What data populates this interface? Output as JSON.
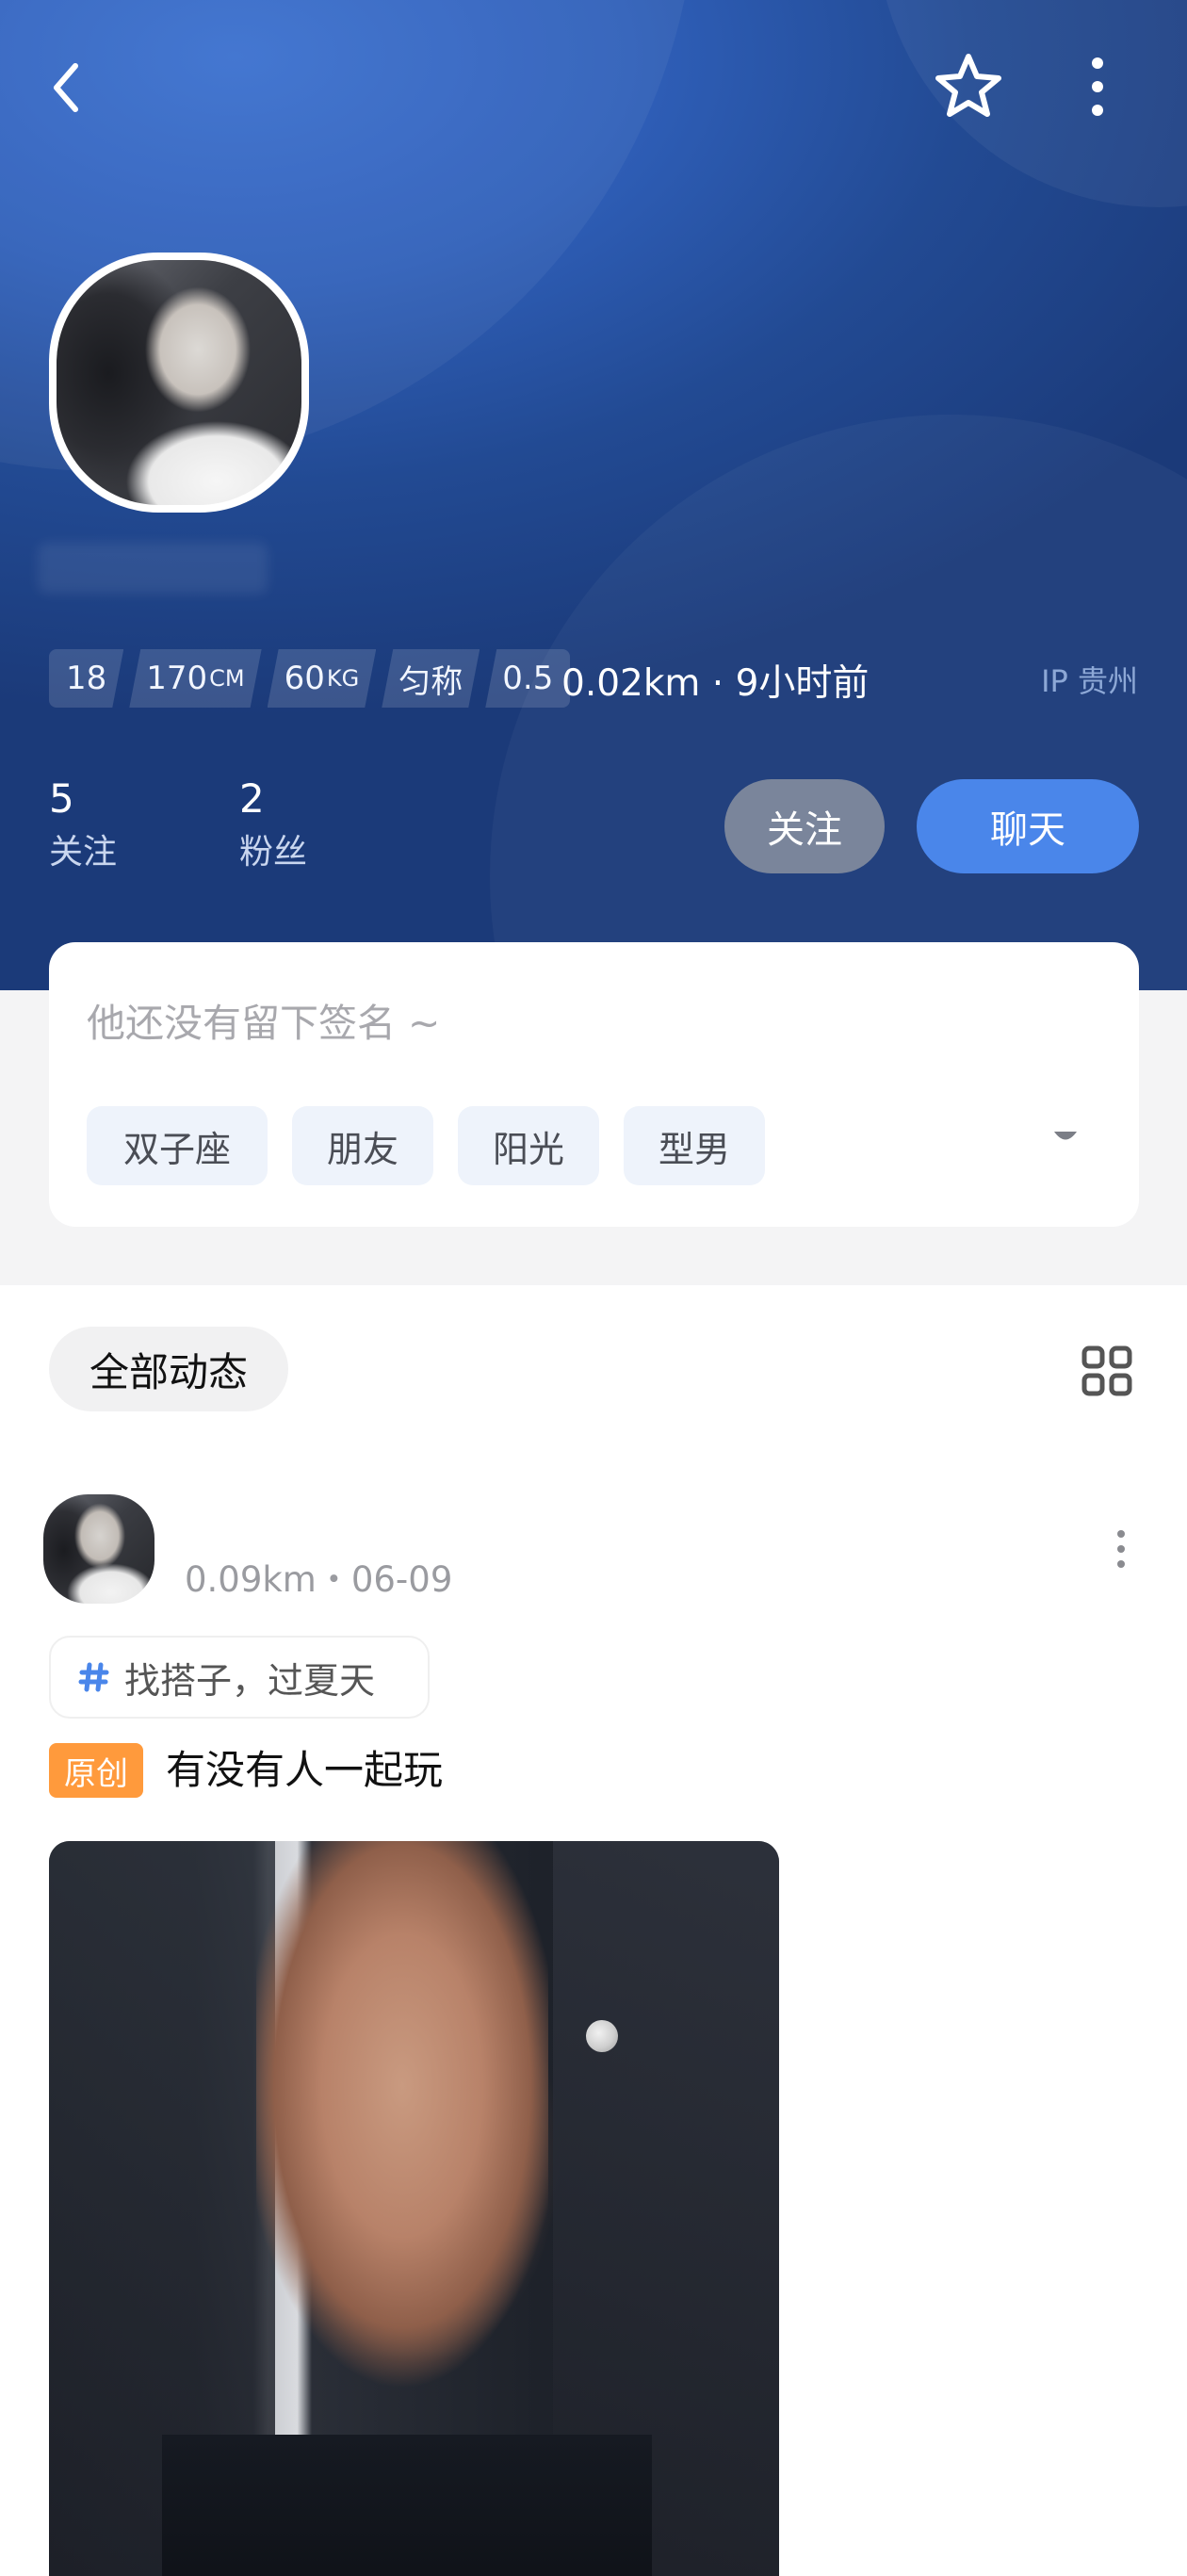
{
  "header": {
    "stats": [
      {
        "value": "18",
        "unit": ""
      },
      {
        "value": "170",
        "unit": "CM"
      },
      {
        "value": "60",
        "unit": "KG"
      },
      {
        "value": "匀称",
        "unit": ""
      },
      {
        "value": "0.5",
        "unit": ""
      }
    ],
    "distance_time": "0.02km · 9小时前",
    "ip_location": "IP 贵州",
    "following_count": "5",
    "following_label": "关注",
    "followers_count": "2",
    "followers_label": "粉丝",
    "follow_button": "关注",
    "chat_button": "聊天",
    "icons": {
      "back": "chevron-left-icon",
      "favorite": "star-outline-icon",
      "more": "more-vertical-icon"
    }
  },
  "profile_card": {
    "signature_placeholder": "他还没有留下签名 ~",
    "tags": [
      "双子座",
      "朋友",
      "阳光",
      "型男"
    ]
  },
  "feed": {
    "filter_label": "全部动态",
    "post": {
      "meta": "0.09km・06-09",
      "topic": "找搭子，过夏天",
      "badge": "原创",
      "title": "有没有人一起玩"
    }
  },
  "colors": {
    "header_blue": "#2f5fb9",
    "chat_button": "#4a86ea",
    "follow_button": "#7a859b",
    "original_badge": "#ff9a3c"
  }
}
